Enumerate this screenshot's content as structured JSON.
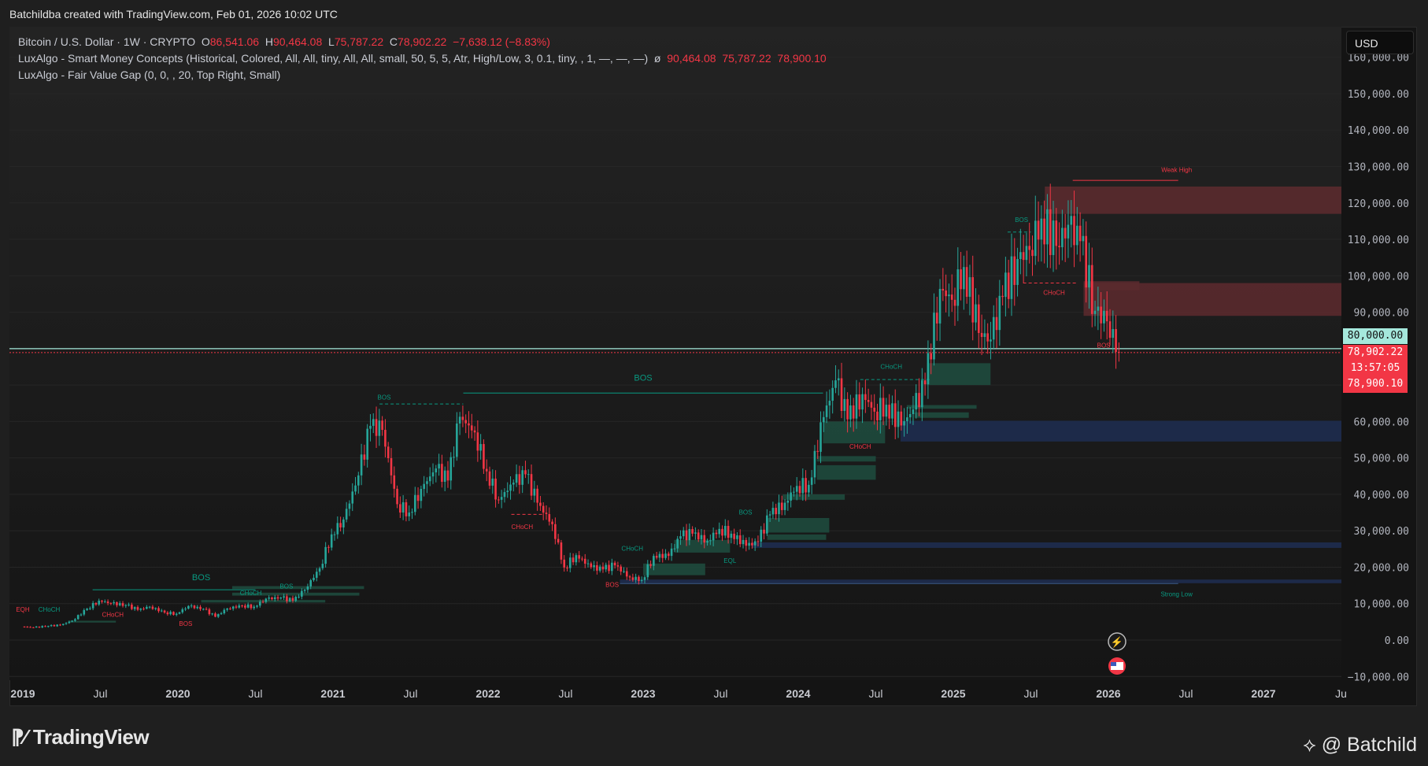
{
  "attribution": "Batchildba created with TradingView.com, Feb 01, 2026 10:02 UTC",
  "legend": {
    "symbol": "Bitcoin / U.S. Dollar · 1W · CRYPTO",
    "o_label": "O",
    "o": "86,541.06",
    "h_label": "H",
    "h": "90,464.08",
    "l_label": "L",
    "l": "75,787.22",
    "c_label": "C",
    "c": "78,902.22",
    "change": "−7,638.12 (−8.83%)",
    "smc": "LuxAlgo - Smart Money Concepts (Historical, Colored, All, All, tiny, All, All, small, 50, 5, 5, Atr, High/Low, 3, 0.1, tiny, , 1, —, —, —)",
    "smc_sym": "ø",
    "smc_v1": "90,464.08",
    "smc_v2": "75,787.22",
    "smc_v3": "78,900.10",
    "fvg": "LuxAlgo - Fair Value Gap (0, 0, , 20, Top Right, Small)"
  },
  "currency_button": "USD",
  "price_tags": {
    "alert": "80,000.00",
    "last": "78,902.22",
    "countdown": "13:57:05",
    "indicator": "78,900.10"
  },
  "colors": {
    "up": "#26a69a",
    "down": "#f23645",
    "smc_green": "#089981",
    "ob_green": "#1e4d40",
    "ob_red": "#5a2a2e",
    "discount": "#1e2c4f"
  },
  "chart_data": {
    "type": "candlestick",
    "interval": "1W",
    "start": 2019.0,
    "first_open": 3700,
    "monthly_closes": [
      3450,
      3850,
      4100,
      5300,
      8600,
      10800,
      10100,
      9600,
      8300,
      9150,
      7550,
      7200,
      9350,
      8550,
      6400,
      8650,
      9450,
      9150,
      11350,
      11650,
      10800,
      13800,
      19700,
      29000,
      33100,
      45200,
      58800,
      57700,
      37300,
      35000,
      41500,
      47100,
      43800,
      61300,
      57000,
      46300,
      38500,
      43200,
      45500,
      37700,
      31800,
      19900,
      23300,
      20000,
      19400,
      20500,
      17200,
      16500,
      23100,
      23100,
      28500,
      29200,
      27200,
      30500,
      29200,
      25900,
      27000,
      34500,
      37700,
      42300,
      42600,
      61200,
      71300,
      60600,
      67500,
      62700,
      64600,
      58900,
      63300,
      70200,
      96400,
      93400,
      102400,
      84300,
      82500,
      94200,
      104600,
      107100,
      115700,
      108200,
      114000,
      109500,
      90400,
      87500,
      78902.22
    ],
    "y_ticks": [
      160000,
      150000,
      140000,
      130000,
      120000,
      110000,
      100000,
      90000,
      80000,
      70000,
      60000,
      50000,
      40000,
      30000,
      20000,
      10000,
      0,
      -10000
    ],
    "y_tick_labels": [
      "160,000.00",
      "150,000.00",
      "140,000.00",
      "130,000.00",
      "120,000.00",
      "110,000.00",
      "100,000.00",
      "90,000.00",
      "",
      "",
      "60,000.00",
      "50,000.00",
      "40,000.00",
      "30,000.00",
      "20,000.00",
      "10,000.00",
      "0.00",
      "−10,000.00"
    ],
    "x_ticks": [
      2019,
      2019.5,
      2020,
      2020.5,
      2021,
      2021.5,
      2022,
      2022.5,
      2023,
      2023.5,
      2024,
      2024.5,
      2025,
      2025.5,
      2026,
      2026.5,
      2027,
      2027.5
    ],
    "x_tick_labels": [
      "2019",
      "Jul",
      "2020",
      "Jul",
      "2021",
      "Jul",
      "2022",
      "Jul",
      "2023",
      "Jul",
      "2024",
      "Jul",
      "2025",
      "Jul",
      "2026",
      "Jul",
      "2027",
      "Ju"
    ],
    "ylim": [
      -12000,
      165000
    ],
    "xlim": [
      2018.92,
      2027.53
    ],
    "last_price": 78902.22,
    "zones": [
      {
        "kind": "supply",
        "t0": 2025.59,
        "t1": 2027.53,
        "p0": 117000,
        "p1": 124500
      },
      {
        "kind": "supply",
        "t0": 2025.84,
        "t1": 2027.53,
        "p0": 89000,
        "p1": 98000
      },
      {
        "kind": "supply",
        "t0": 2025.84,
        "t1": 2026.2,
        "p0": 96000,
        "p1": 98500
      },
      {
        "kind": "demand",
        "t0": 2024.66,
        "t1": 2027.53,
        "p0": 54500,
        "p1": 60200
      },
      {
        "kind": "demand",
        "t0": 2023.7,
        "t1": 2027.53,
        "p0": 25300,
        "p1": 26800
      },
      {
        "kind": "demand",
        "t0": 2022.85,
        "t1": 2027.53,
        "p0": 15600,
        "p1": 16600
      },
      {
        "kind": "ob",
        "t0": 2024.83,
        "t1": 2025.24,
        "p0": 70000,
        "p1": 76000
      },
      {
        "kind": "ob",
        "t0": 2024.16,
        "t1": 2024.56,
        "p0": 54000,
        "p1": 60000
      },
      {
        "kind": "ob",
        "t0": 2024.12,
        "t1": 2024.5,
        "p0": 44000,
        "p1": 48000
      },
      {
        "kind": "ob",
        "t0": 2024.12,
        "t1": 2024.5,
        "p0": 49000,
        "p1": 50500
      },
      {
        "kind": "ob",
        "t0": 2023.9,
        "t1": 2024.3,
        "p0": 38500,
        "p1": 40000
      },
      {
        "kind": "ob",
        "t0": 2023.8,
        "t1": 2024.2,
        "p0": 29500,
        "p1": 33500
      },
      {
        "kind": "ob",
        "t0": 2023.8,
        "t1": 2024.18,
        "p0": 27500,
        "p1": 29000
      },
      {
        "kind": "ob",
        "t0": 2023.2,
        "t1": 2023.56,
        "p0": 24000,
        "p1": 27500
      },
      {
        "kind": "ob",
        "t0": 2023.0,
        "t1": 2023.4,
        "p0": 17800,
        "p1": 21000
      },
      {
        "kind": "ob",
        "t0": 2024.7,
        "t1": 2025.15,
        "p0": 63500,
        "p1": 64500
      },
      {
        "kind": "ob",
        "t0": 2024.75,
        "t1": 2025.1,
        "p0": 61000,
        "p1": 62500
      },
      {
        "kind": "ob",
        "t0": 2020.35,
        "t1": 2021.2,
        "p0": 14000,
        "p1": 14800
      },
      {
        "kind": "ob",
        "t0": 2020.35,
        "t1": 2021.17,
        "p0": 12200,
        "p1": 13000
      },
      {
        "kind": "ob",
        "t0": 2020.15,
        "t1": 2020.95,
        "p0": 10300,
        "p1": 11000
      },
      {
        "kind": "ob",
        "t0": 2019.3,
        "t1": 2019.6,
        "p0": 4800,
        "p1": 5300
      }
    ],
    "lines": [
      {
        "kind": "bos",
        "t0": 2021.84,
        "t1": 2024.16,
        "p": 67800,
        "dash": false
      },
      {
        "kind": "bos",
        "t0": 2021.3,
        "t1": 2021.84,
        "p": 64800,
        "dash": true
      },
      {
        "kind": "bos",
        "t0": 2019.45,
        "t1": 2020.5,
        "p": 13800,
        "dash": false
      },
      {
        "kind": "weak",
        "t0": 2025.77,
        "t1": 2026.45,
        "p": 126200,
        "dash": false
      },
      {
        "kind": "choch_red",
        "t0": 2025.45,
        "t1": 2025.8,
        "p": 98000,
        "dash": true
      },
      {
        "kind": "choch_red",
        "t0": 2022.15,
        "t1": 2022.35,
        "p": 34500,
        "dash": true
      },
      {
        "kind": "strong",
        "t0": 2022.85,
        "t1": 2026.45,
        "p": 15500,
        "dash": false
      },
      {
        "kind": "bos",
        "t0": 2024.4,
        "t1": 2024.85,
        "p": 71500,
        "dash": true
      },
      {
        "kind": "bos",
        "t0": 2025.35,
        "t1": 2025.5,
        "p": 112000,
        "dash": true
      }
    ],
    "labels": [
      {
        "text": "EQH",
        "t": 2019.0,
        "p": 7800,
        "color": "red"
      },
      {
        "text": "CHoCH",
        "t": 2019.17,
        "p": 7800,
        "color": "green"
      },
      {
        "text": "CHoCH",
        "t": 2019.58,
        "p": 6400,
        "color": "red"
      },
      {
        "text": "BOS",
        "t": 2020.05,
        "p": 3900,
        "color": "red"
      },
      {
        "text": "BOS",
        "t": 2020.15,
        "p": 16400,
        "color": "green",
        "big": true
      },
      {
        "text": "CHoCH",
        "t": 2020.47,
        "p": 12300,
        "color": "green"
      },
      {
        "text": "BOS",
        "t": 2020.7,
        "p": 14200,
        "color": "green"
      },
      {
        "text": "BOS",
        "t": 2021.33,
        "p": 66000,
        "color": "green"
      },
      {
        "text": "BOS",
        "t": 2023.0,
        "p": 71200,
        "color": "green",
        "big": true
      },
      {
        "text": "CHoCH",
        "t": 2022.22,
        "p": 30500,
        "color": "red"
      },
      {
        "text": "CHoCH",
        "t": 2022.93,
        "p": 24500,
        "color": "green"
      },
      {
        "text": "BOS",
        "t": 2022.8,
        "p": 14600,
        "color": "red"
      },
      {
        "text": "EQL",
        "t": 2023.56,
        "p": 21200,
        "color": "green"
      },
      {
        "text": "BOS",
        "t": 2023.66,
        "p": 34500,
        "color": "green"
      },
      {
        "text": "CHoCH",
        "t": 2024.6,
        "p": 74500,
        "color": "green"
      },
      {
        "text": "CHoCH",
        "t": 2024.4,
        "p": 52500,
        "color": "red"
      },
      {
        "text": "BOS",
        "t": 2025.44,
        "p": 114800,
        "color": "green"
      },
      {
        "text": "CHoCH",
        "t": 2025.65,
        "p": 94800,
        "color": "red"
      },
      {
        "text": "BOS",
        "t": 2025.97,
        "p": 80300,
        "color": "red"
      },
      {
        "text": "Weak High",
        "t": 2026.44,
        "p": 128500,
        "color": "red"
      },
      {
        "text": "Strong Low",
        "t": 2026.44,
        "p": 12000,
        "color": "green"
      }
    ]
  },
  "branding": {
    "logo": "TradingView",
    "author": "@ Batchild"
  }
}
